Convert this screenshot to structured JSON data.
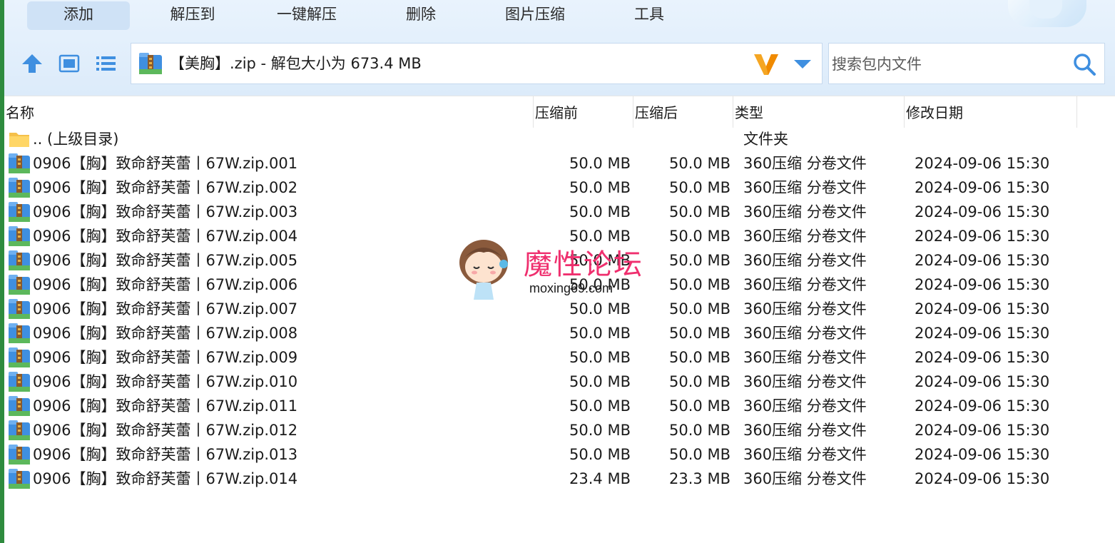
{
  "menu": {
    "items": [
      {
        "label": "添加",
        "active": true
      },
      {
        "label": "解压到",
        "active": false
      },
      {
        "label": "一键解压",
        "active": false
      },
      {
        "label": "删除",
        "active": false
      },
      {
        "label": "图片压缩",
        "active": false
      },
      {
        "label": "工具",
        "active": false
      }
    ]
  },
  "path": {
    "text": "【美胸】.zip - 解包大小为 673.4 MB"
  },
  "search": {
    "placeholder": "搜索包内文件"
  },
  "columns": {
    "name": "名称",
    "before": "压缩前",
    "after": "压缩后",
    "type": "类型",
    "date": "修改日期"
  },
  "parent_row": {
    "name": ".. (上级目录)",
    "type": "文件夹"
  },
  "files": [
    {
      "name": "0906【胸】致命舒芙蕾丨67W.zip.001",
      "before": "50.0 MB",
      "after": "50.0 MB",
      "type": "360压缩 分卷文件",
      "date": "2024-09-06 15:30"
    },
    {
      "name": "0906【胸】致命舒芙蕾丨67W.zip.002",
      "before": "50.0 MB",
      "after": "50.0 MB",
      "type": "360压缩 分卷文件",
      "date": "2024-09-06 15:30"
    },
    {
      "name": "0906【胸】致命舒芙蕾丨67W.zip.003",
      "before": "50.0 MB",
      "after": "50.0 MB",
      "type": "360压缩 分卷文件",
      "date": "2024-09-06 15:30"
    },
    {
      "name": "0906【胸】致命舒芙蕾丨67W.zip.004",
      "before": "50.0 MB",
      "after": "50.0 MB",
      "type": "360压缩 分卷文件",
      "date": "2024-09-06 15:30"
    },
    {
      "name": "0906【胸】致命舒芙蕾丨67W.zip.005",
      "before": "50.0 MB",
      "after": "50.0 MB",
      "type": "360压缩 分卷文件",
      "date": "2024-09-06 15:30"
    },
    {
      "name": "0906【胸】致命舒芙蕾丨67W.zip.006",
      "before": "50.0 MB",
      "after": "50.0 MB",
      "type": "360压缩 分卷文件",
      "date": "2024-09-06 15:30"
    },
    {
      "name": "0906【胸】致命舒芙蕾丨67W.zip.007",
      "before": "50.0 MB",
      "after": "50.0 MB",
      "type": "360压缩 分卷文件",
      "date": "2024-09-06 15:30"
    },
    {
      "name": "0906【胸】致命舒芙蕾丨67W.zip.008",
      "before": "50.0 MB",
      "after": "50.0 MB",
      "type": "360压缩 分卷文件",
      "date": "2024-09-06 15:30"
    },
    {
      "name": "0906【胸】致命舒芙蕾丨67W.zip.009",
      "before": "50.0 MB",
      "after": "50.0 MB",
      "type": "360压缩 分卷文件",
      "date": "2024-09-06 15:30"
    },
    {
      "name": "0906【胸】致命舒芙蕾丨67W.zip.010",
      "before": "50.0 MB",
      "after": "50.0 MB",
      "type": "360压缩 分卷文件",
      "date": "2024-09-06 15:30"
    },
    {
      "name": "0906【胸】致命舒芙蕾丨67W.zip.011",
      "before": "50.0 MB",
      "after": "50.0 MB",
      "type": "360压缩 分卷文件",
      "date": "2024-09-06 15:30"
    },
    {
      "name": "0906【胸】致命舒芙蕾丨67W.zip.012",
      "before": "50.0 MB",
      "after": "50.0 MB",
      "type": "360压缩 分卷文件",
      "date": "2024-09-06 15:30"
    },
    {
      "name": "0906【胸】致命舒芙蕾丨67W.zip.013",
      "before": "50.0 MB",
      "after": "50.0 MB",
      "type": "360压缩 分卷文件",
      "date": "2024-09-06 15:30"
    },
    {
      "name": "0906【胸】致命舒芙蕾丨67W.zip.014",
      "before": "23.4 MB",
      "after": "23.3 MB",
      "type": "360压缩 分卷文件",
      "date": "2024-09-06 15:30"
    }
  ],
  "watermark": {
    "title": "魔性论坛",
    "url": "moxing69.com"
  },
  "colors": {
    "accent_green": "#2e8b3e",
    "toolbar_bg": "#e4f0fc",
    "watermark_pink": "#ef2f6e",
    "icon_blue": "#3f8fe0"
  },
  "icons": {
    "up": "arrow-up-icon",
    "thumbnail_view": "thumbnail-view-icon",
    "list_view": "list-view-icon",
    "archive": "archive-icon",
    "brand": "v-logo-icon",
    "dropdown": "chevron-down-icon",
    "search": "search-icon",
    "folder": "folder-icon"
  }
}
